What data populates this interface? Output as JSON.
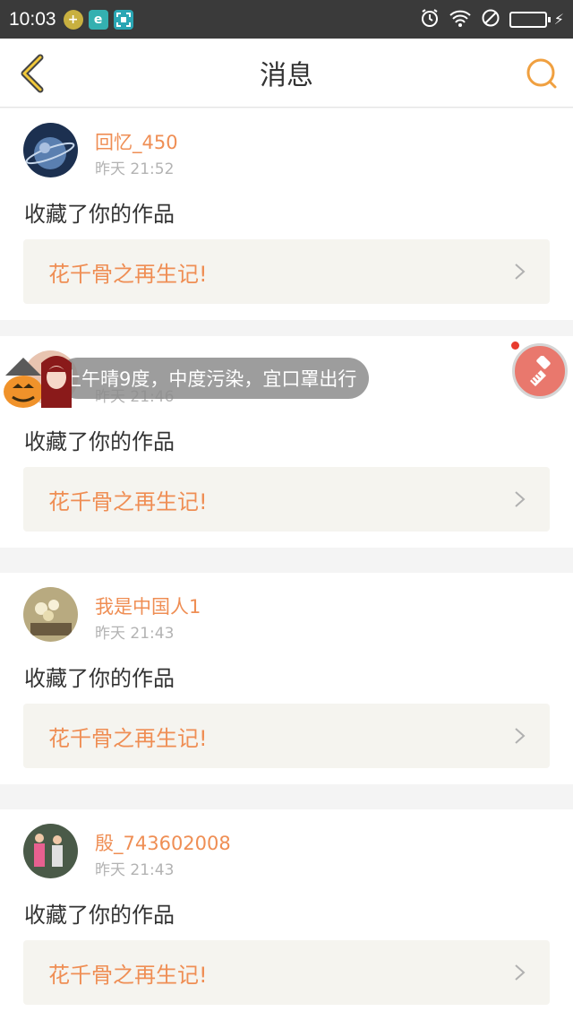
{
  "status_bar": {
    "time": "10:03",
    "apps": [
      {
        "icon": "plus-app-icon",
        "glyph": "+",
        "color": "#c8b040"
      },
      {
        "icon": "e-app-icon",
        "glyph": "e",
        "color": "#34b0b0"
      },
      {
        "icon": "scan-app-icon",
        "glyph": "⊡",
        "color": "#2aa6b4"
      }
    ],
    "right_icons": [
      "alarm-icon",
      "wifi-icon",
      "do-not-disturb-icon",
      "battery-icon"
    ]
  },
  "nav": {
    "title": "消息",
    "accent": "#f0a040"
  },
  "messages": [
    {
      "user": "回忆_450",
      "time": "昨天 21:52",
      "action": "收藏了你的作品",
      "work": "花千骨之再生记!",
      "avatar": "planet-avatar"
    },
    {
      "user": "",
      "time": "昨天 21:46",
      "action": "收藏了你的作品",
      "work": "花千骨之再生记!",
      "avatar": "hidden-avatar"
    },
    {
      "user": "我是中国人1",
      "time": "昨天 21:43",
      "action": "收藏了你的作品",
      "work": "花千骨之再生记!",
      "avatar": "flower-avatar"
    },
    {
      "user": "殷_743602008",
      "time": "昨天 21:43",
      "action": "收藏了你的作品",
      "work": "花千骨之再生记!",
      "avatar": "kids-avatar"
    }
  ],
  "overlay": {
    "weather_text": "上午晴9度，中度污染，宜口罩出行"
  },
  "colors": {
    "orange_text": "#ef8e54",
    "link_bg": "#f5f4ef",
    "float_ball": "#e9786d"
  }
}
